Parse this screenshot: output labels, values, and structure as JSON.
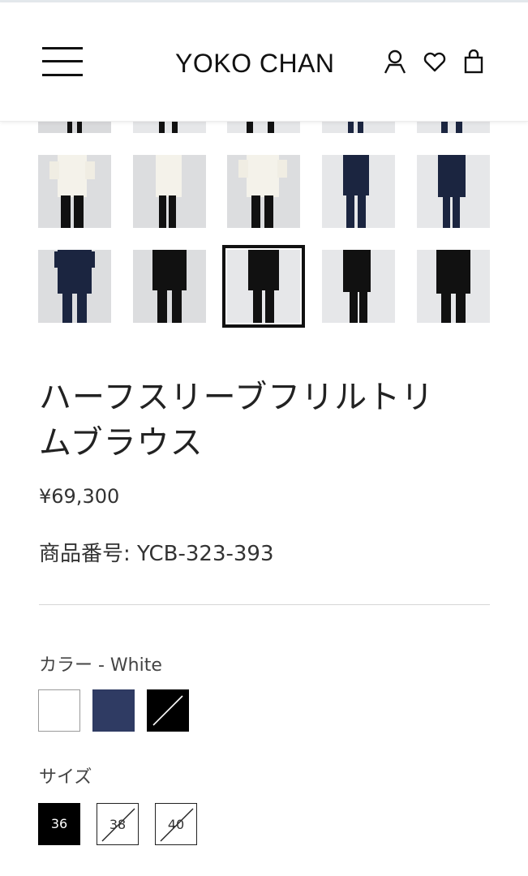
{
  "header": {
    "logo": "YOKO CHAN",
    "icons": [
      "menu-icon",
      "account-icon",
      "heart-icon",
      "shopping-bag-icon"
    ]
  },
  "gallery": {
    "row_partial": [
      "white",
      "white",
      "white",
      "navy",
      "navy"
    ],
    "row_1": [
      "white",
      "white",
      "white",
      "navy",
      "navy"
    ],
    "row_2": [
      "navy",
      "black",
      "black",
      "black",
      "black"
    ],
    "selected_index": 12
  },
  "product": {
    "title_line1": "ハーフスリーブフリルトリ",
    "title_line2": "ムブラウス",
    "price": "¥69,300",
    "sku": "商品番号: YCB-323-393"
  },
  "color": {
    "label": "カラー - White",
    "swatches": [
      {
        "name": "White",
        "hex": "#ffffff",
        "available": true,
        "selected": true
      },
      {
        "name": "Navy",
        "hex": "#2f3b63",
        "available": true,
        "selected": false
      },
      {
        "name": "Black",
        "hex": "#000000",
        "available": false,
        "selected": false
      }
    ]
  },
  "size": {
    "label": "サイズ",
    "options": [
      {
        "label": "36",
        "selected": true,
        "available": true
      },
      {
        "label": "38",
        "selected": false,
        "available": false
      },
      {
        "label": "40",
        "selected": false,
        "available": false
      }
    ]
  }
}
